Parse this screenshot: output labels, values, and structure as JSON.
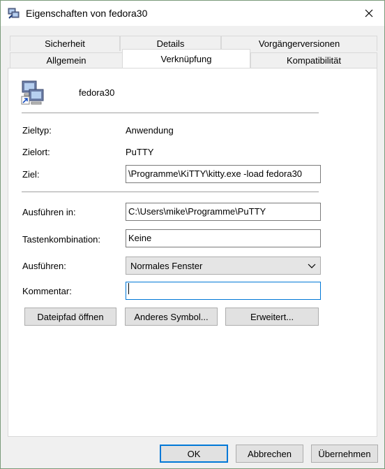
{
  "window": {
    "title": "Eigenschaften von fedora30"
  },
  "tabs_row1": [
    "Sicherheit",
    "Details",
    "Vorgängerversionen"
  ],
  "tabs_row2": [
    "Allgemein",
    "Verknüpfung",
    "Kompatibilität"
  ],
  "shortcut": {
    "name": "fedora30"
  },
  "fields": {
    "zieltyp_label": "Zieltyp:",
    "zieltyp_value": "Anwendung",
    "zielort_label": "Zielort:",
    "zielort_value": "PuTTY",
    "ziel_label": "Ziel:",
    "ziel_value": "\\Programme\\KiTTY\\kitty.exe -load fedora30",
    "ausfuehren_in_label": "Ausführen in:",
    "ausfuehren_in_value": "C:\\Users\\mike\\Programme\\PuTTY",
    "tastenkombination_label": "Tastenkombination:",
    "tastenkombination_value": "Keine",
    "ausfuehren_label": "Ausführen:",
    "ausfuehren_value": "Normales Fenster",
    "kommentar_label": "Kommentar:",
    "kommentar_value": ""
  },
  "buttons": {
    "dateipfad": "Dateipfad öffnen",
    "anderes_symbol": "Anderes Symbol...",
    "erweitert": "Erweitert...",
    "ok": "OK",
    "abbrechen": "Abbrechen",
    "uebernehmen": "Übernehmen"
  },
  "colors": {
    "accent": "#0078d7",
    "panel_bg": "#ffffff",
    "window_bg": "#f0f0f0"
  },
  "icons": {
    "title": "putty-computer-icon",
    "shortcut": "putty-computer-icon",
    "close": "close-icon",
    "dropdown": "chevron-down-icon"
  }
}
